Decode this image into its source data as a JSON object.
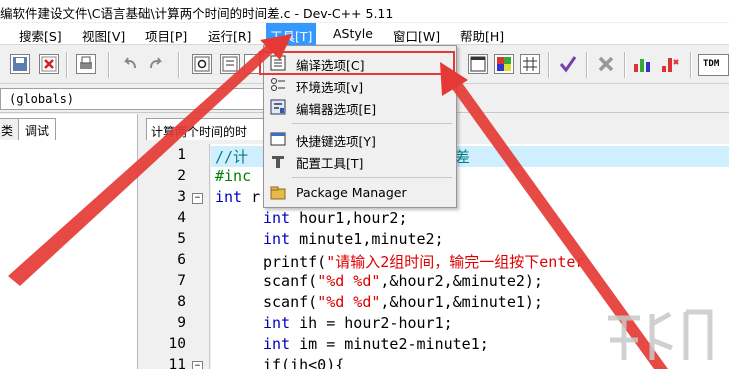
{
  "window": {
    "title": "编软件建设文件\\C语言基础\\计算两个时间的时间差.c - Dev-C++ 5.11"
  },
  "menu": {
    "items": [
      "搜索[S]",
      "视图[V]",
      "项目[P]",
      "运行[R]",
      "工具[T]",
      "AStyle",
      "窗口[W]",
      "帮助[H]"
    ],
    "active": "工具[T]"
  },
  "toolbar": {
    "tdm_label": "TDM"
  },
  "globals": {
    "combo_value": "(globals)"
  },
  "left_panel": {
    "tabs": [
      "类",
      "调试"
    ]
  },
  "editor": {
    "tab_label": "计算两个时间的时",
    "line_numbers": [
      "1",
      "2",
      "3",
      "4",
      "5",
      "6",
      "7",
      "8",
      "9",
      "10",
      "11"
    ],
    "lines": [
      {
        "comment": "//计",
        "tail": "差"
      },
      {
        "pp": "#inc"
      },
      {
        "kw": "int",
        "rest": " r"
      },
      {
        "kw": "int",
        "rest": " hour1,hour2;"
      },
      {
        "kw": "int",
        "rest": " minute1,minute2;"
      },
      {
        "fn": "printf(",
        "str": "\"请输入2组时间，输完一组按下enter"
      },
      {
        "fn": "scanf(",
        "str": "\"%d %d\"",
        "rest": ",&hour2,&minute2);"
      },
      {
        "fn": "scanf(",
        "str": "\"%d %d\"",
        "rest": ",&hour1,&minute1);"
      },
      {
        "kw": "int",
        "rest": " ih = hour2-hour1;"
      },
      {
        "kw": "int",
        "rest": " im = minute2-minute1;"
      },
      {
        "fn": "if(ih<0){"
      }
    ]
  },
  "dropdown": {
    "items": [
      {
        "label": "编译选项[C]",
        "icon": "compiler-options-icon"
      },
      {
        "label": "环境选项[v]",
        "icon": "environment-options-icon"
      },
      {
        "label": "编辑器选项[E]",
        "icon": "editor-options-icon"
      },
      {
        "label": "快捷键选项[Y]",
        "icon": "shortcut-options-icon"
      },
      {
        "label": "配置工具[T]",
        "icon": "configure-tools-icon"
      },
      {
        "label": "Package Manager",
        "icon": "package-manager-icon"
      }
    ]
  },
  "colors": {
    "menu_active_bg": "#3399ff",
    "annotation_red": "#e53935",
    "keyword_blue": "#0000c0",
    "string_red": "#e00000",
    "line_highlight": "#cfefff"
  }
}
